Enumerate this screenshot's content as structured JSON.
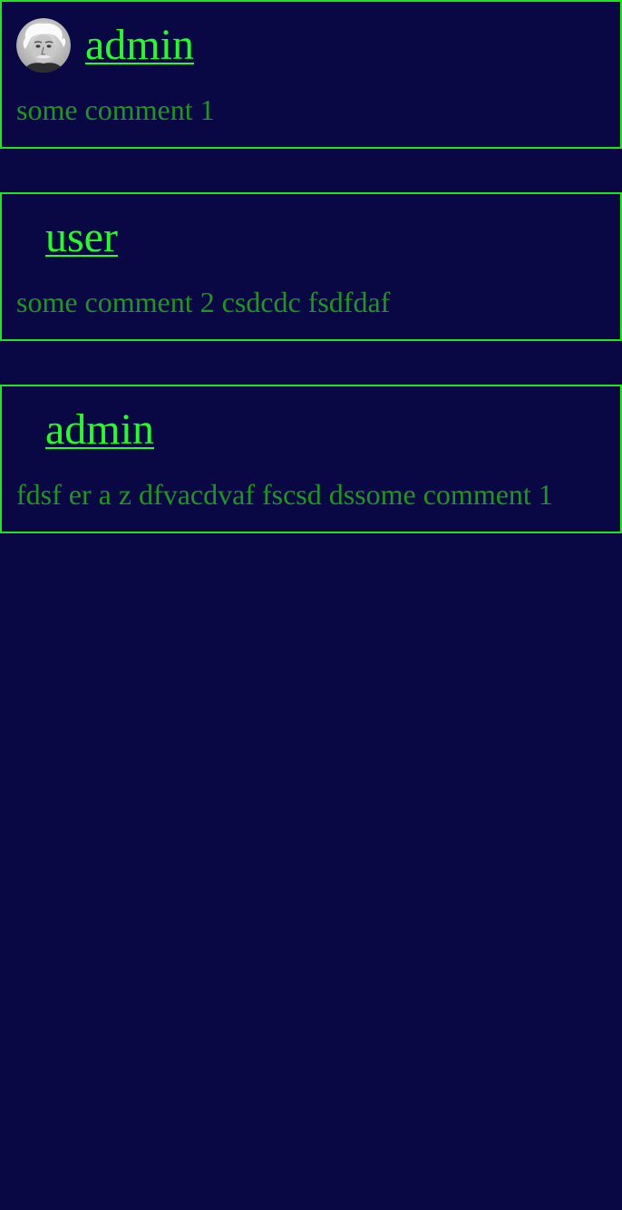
{
  "comments": [
    {
      "username": "admin",
      "text": "some comment 1",
      "has_avatar": true
    },
    {
      "username": "user",
      "text": "some comment 2 csdcdc fsdfdaf",
      "has_avatar": false
    },
    {
      "username": "admin",
      "text": "fdsf er a z dfvacdvaf fscsd dssome comment 1",
      "has_avatar": false
    }
  ],
  "colors": {
    "background": "#0a0745",
    "border": "#1ee61e",
    "username": "#22ff22",
    "comment_text": "#1f961f"
  }
}
